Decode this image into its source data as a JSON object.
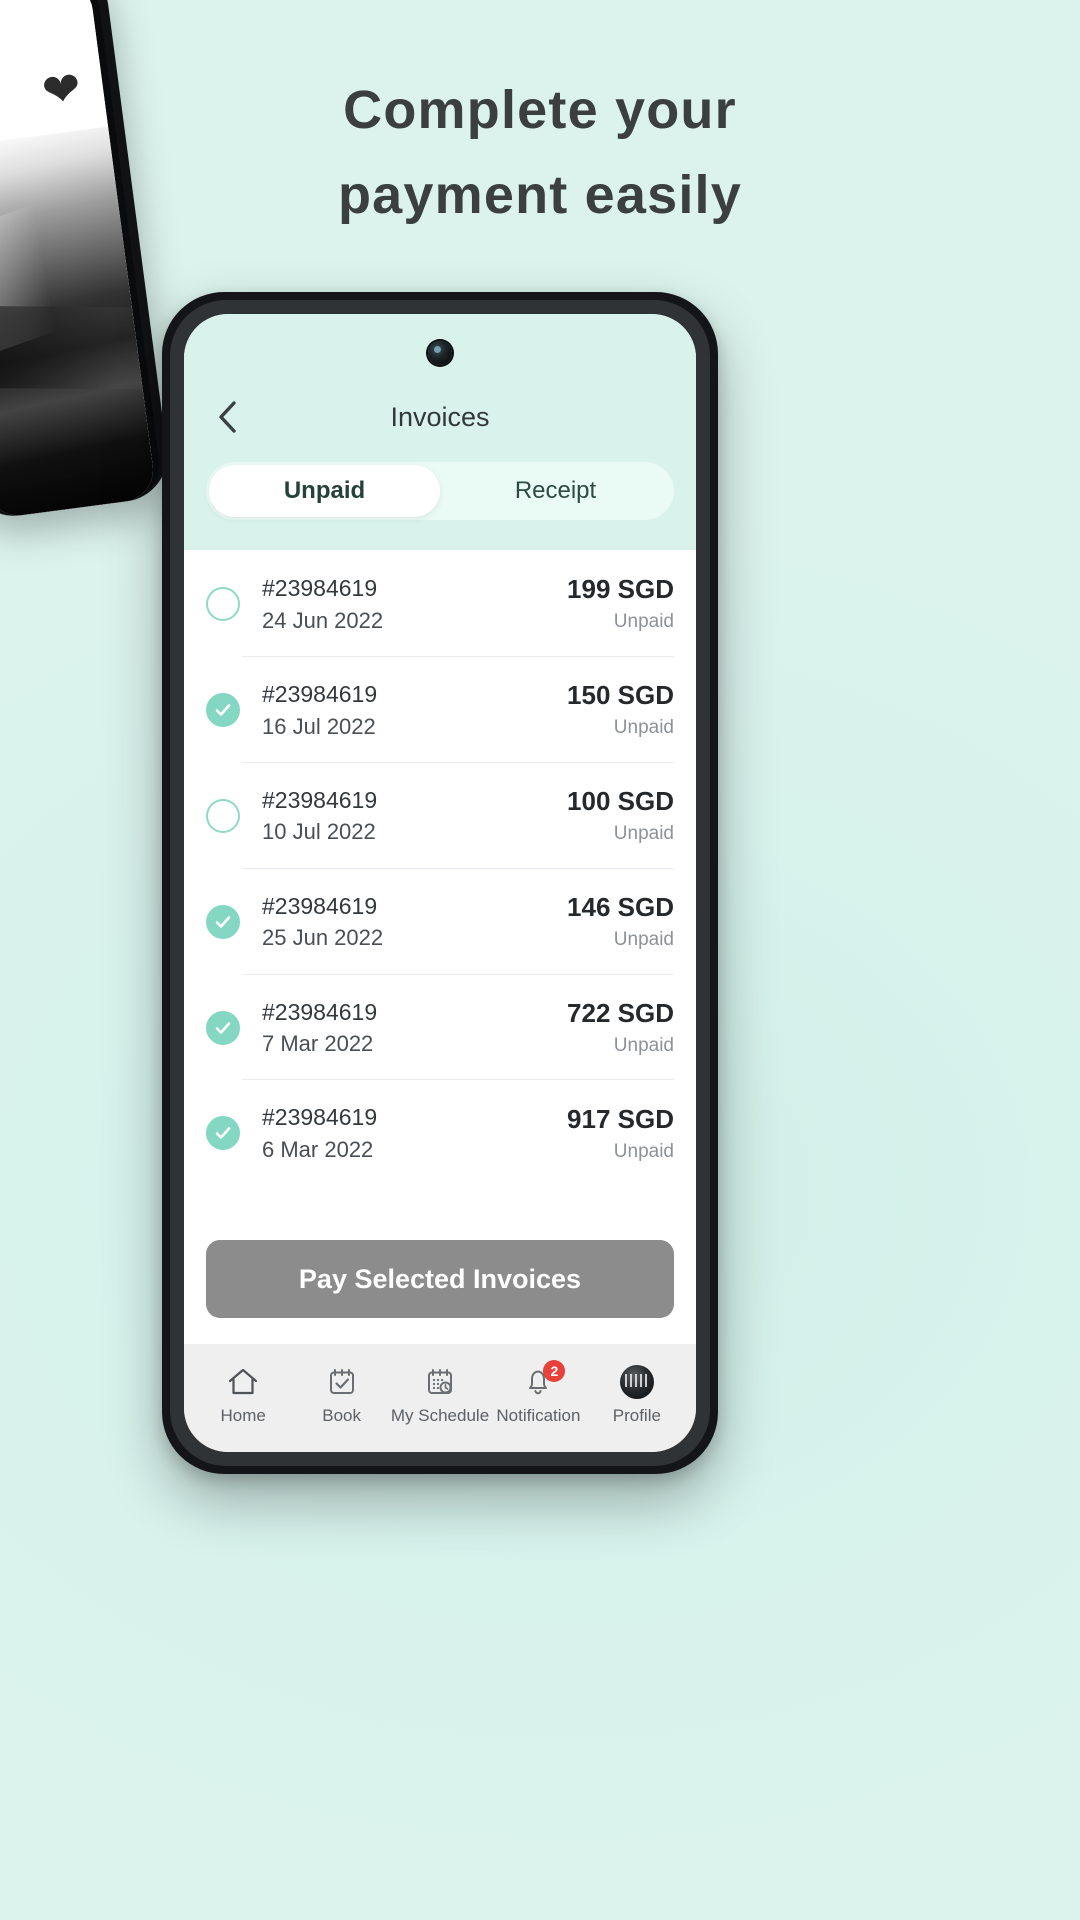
{
  "promo": {
    "headline_line1": "Complete your",
    "headline_line2": "payment easily",
    "background_color": "#d8f2ec",
    "heart_icon": "heart-icon"
  },
  "phone": {
    "header": {
      "back_icon": "chevron-left-icon",
      "title": "Invoices"
    },
    "tabs": [
      {
        "label": "Unpaid",
        "active": true
      },
      {
        "label": "Receipt",
        "active": false
      }
    ],
    "invoices": [
      {
        "id": "#23984619",
        "date": "24 Jun 2022",
        "amount": "199 SGD",
        "status": "Unpaid",
        "checked": false
      },
      {
        "id": "#23984619",
        "date": "16 Jul 2022",
        "amount": "150 SGD",
        "status": "Unpaid",
        "checked": true
      },
      {
        "id": "#23984619",
        "date": "10 Jul 2022",
        "amount": "100 SGD",
        "status": "Unpaid",
        "checked": false
      },
      {
        "id": "#23984619",
        "date": "25 Jun 2022",
        "amount": "146 SGD",
        "status": "Unpaid",
        "checked": true
      },
      {
        "id": "#23984619",
        "date": "7 Mar 2022",
        "amount": "722 SGD",
        "status": "Unpaid",
        "checked": true
      },
      {
        "id": "#23984619",
        "date": "6 Mar 2022",
        "amount": "917 SGD",
        "status": "Unpaid",
        "checked": true
      }
    ],
    "pay_button": {
      "label": "Pay Selected Invoices",
      "color": "#8c8c8c"
    },
    "bottom_nav": [
      {
        "label": "Home",
        "icon": "home-icon"
      },
      {
        "label": "Book",
        "icon": "calendar-check-icon"
      },
      {
        "label": "My Schedule",
        "icon": "calendar-clock-icon"
      },
      {
        "label": "Notification",
        "icon": "bell-icon",
        "badge": "2"
      },
      {
        "label": "Profile",
        "icon": "avatar-icon"
      }
    ]
  },
  "colors": {
    "accent_mint": "#d9f2ec",
    "check_teal": "#84d7c2",
    "badge_red": "#e8403a"
  }
}
